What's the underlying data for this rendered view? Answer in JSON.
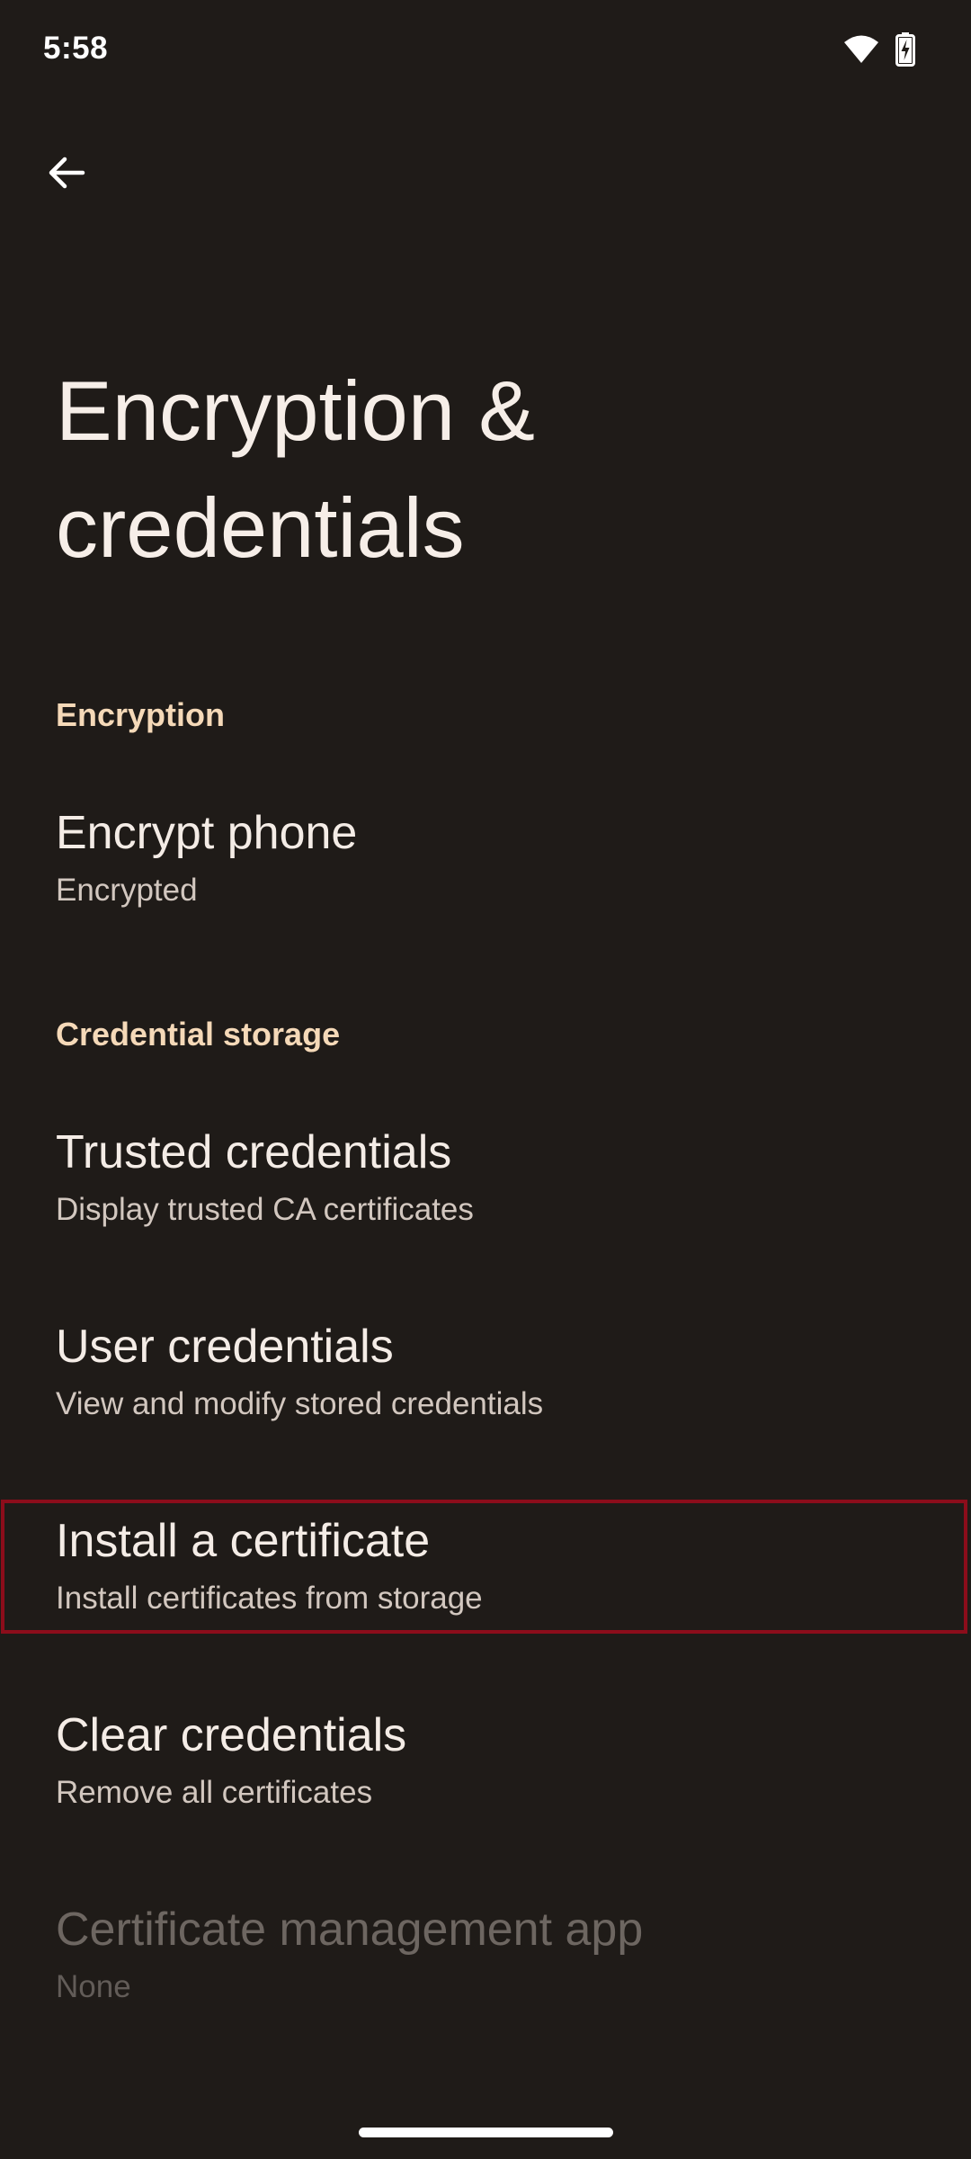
{
  "status_bar": {
    "time": "5:58",
    "icons": [
      "wifi-icon",
      "battery-charging-icon"
    ]
  },
  "toolbar": {
    "back_icon": "arrow-back-icon"
  },
  "page": {
    "title_line1": "Encryption &",
    "title_line2": "credentials"
  },
  "sections": {
    "encryption": {
      "header": "Encryption",
      "encrypt_phone": {
        "title": "Encrypt phone",
        "summary": "Encrypted"
      }
    },
    "credential_storage": {
      "header": "Credential storage",
      "trusted_credentials": {
        "title": "Trusted credentials",
        "summary": "Display trusted CA certificates"
      },
      "user_credentials": {
        "title": "User credentials",
        "summary": "View and modify stored credentials"
      },
      "install_certificate": {
        "title": "Install a certificate",
        "summary": "Install certificates from storage"
      },
      "clear_credentials": {
        "title": "Clear credentials",
        "summary": "Remove all certificates"
      },
      "certificate_management_app": {
        "title": "Certificate management app",
        "summary": "None",
        "enabled": false
      }
    }
  },
  "colors": {
    "background": "#1f1b18",
    "section_header": "#f5d9b8",
    "highlight_border": "#8c0d1b"
  }
}
